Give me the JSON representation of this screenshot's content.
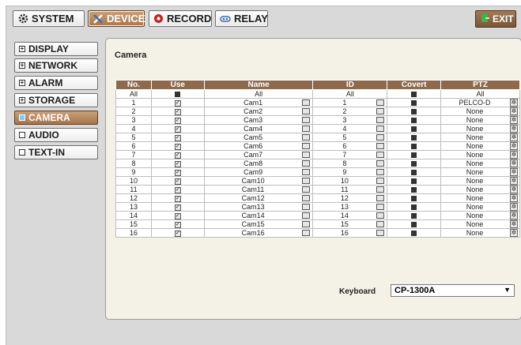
{
  "tabs": [
    {
      "label": "SYSTEM",
      "icon": "gear-icon"
    },
    {
      "label": "DEVICE",
      "icon": "tools-icon",
      "active": true
    },
    {
      "label": "RECORD",
      "icon": "record-icon"
    },
    {
      "label": "RELAY",
      "icon": "relay-icon"
    }
  ],
  "exit_label": "EXIT",
  "menu": [
    {
      "label": "DISPLAY",
      "marker": "⊞"
    },
    {
      "label": "NETWORK",
      "marker": "⊞"
    },
    {
      "label": "ALARM",
      "marker": "⊞"
    },
    {
      "label": "STORAGE",
      "marker": "⊞"
    },
    {
      "label": "CAMERA",
      "marker": "■",
      "active": true
    },
    {
      "label": "AUDIO",
      "marker": "□"
    },
    {
      "label": "TEXT-IN",
      "marker": "□"
    }
  ],
  "panel_title": "Camera",
  "table": {
    "headers": [
      "No.",
      "Use",
      "Name",
      "ID",
      "Covert",
      "PTZ"
    ],
    "all_row": {
      "no": "All",
      "name": "All",
      "id": "All",
      "ptz": "All"
    },
    "rows": [
      {
        "no": "1",
        "name": "Cam1",
        "id": "1",
        "ptz": "PELCO-D"
      },
      {
        "no": "2",
        "name": "Cam2",
        "id": "2",
        "ptz": "None"
      },
      {
        "no": "3",
        "name": "Cam3",
        "id": "3",
        "ptz": "None"
      },
      {
        "no": "4",
        "name": "Cam4",
        "id": "4",
        "ptz": "None"
      },
      {
        "no": "5",
        "name": "Cam5",
        "id": "5",
        "ptz": "None"
      },
      {
        "no": "6",
        "name": "Cam6",
        "id": "6",
        "ptz": "None"
      },
      {
        "no": "7",
        "name": "Cam7",
        "id": "7",
        "ptz": "None"
      },
      {
        "no": "8",
        "name": "Cam8",
        "id": "8",
        "ptz": "None"
      },
      {
        "no": "9",
        "name": "Cam9",
        "id": "9",
        "ptz": "None"
      },
      {
        "no": "10",
        "name": "Cam10",
        "id": "10",
        "ptz": "None"
      },
      {
        "no": "11",
        "name": "Cam11",
        "id": "11",
        "ptz": "None"
      },
      {
        "no": "12",
        "name": "Cam12",
        "id": "12",
        "ptz": "None"
      },
      {
        "no": "13",
        "name": "Cam13",
        "id": "13",
        "ptz": "None"
      },
      {
        "no": "14",
        "name": "Cam14",
        "id": "14",
        "ptz": "None"
      },
      {
        "no": "15",
        "name": "Cam15",
        "id": "15",
        "ptz": "None"
      },
      {
        "no": "16",
        "name": "Cam16",
        "id": "16",
        "ptz": "None"
      }
    ]
  },
  "keyboard": {
    "label": "Keyboard",
    "value": "CP-1300A"
  }
}
